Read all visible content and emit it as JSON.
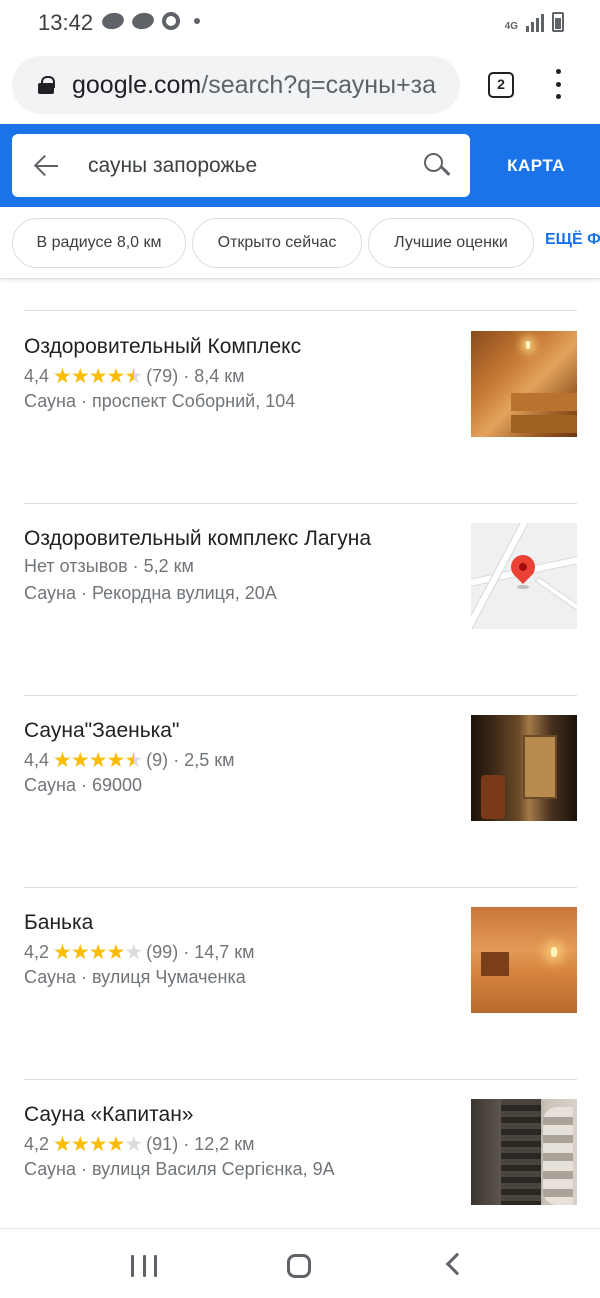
{
  "status_bar": {
    "time": "13:42",
    "network": "4G"
  },
  "browser": {
    "url_host": "google.com",
    "url_path": "/search?q=сауны+за",
    "tab_count": "2"
  },
  "search": {
    "query": "сауны запорожье",
    "map_button": "КАРТА"
  },
  "chips": [
    {
      "label": "В радиусе 8,0 км"
    },
    {
      "label": "Открыто сейчас"
    },
    {
      "label": "Лучшие оценки"
    }
  ],
  "chips_more": "ЕЩЁ Ф",
  "results": [
    {
      "title": "Оздоровительный Комплекс",
      "rating": "4,4",
      "stars": 4.5,
      "reviews": "(79)",
      "distance": "· 8,4 км",
      "address": "Сауна · проспект Соборний, 104",
      "thumb": "sauna-wood-photo"
    },
    {
      "title": "Оздоровительный комплекс Лагуна",
      "no_reviews": "Нет отзывов · 5,2 км",
      "address": "Сауна · Рекордна вулиця, 20А",
      "thumb": "map-pin-thumbnail"
    },
    {
      "title": "Сауна\"Заенька\"",
      "rating": "4,4",
      "stars": 4.5,
      "reviews": "(9)",
      "distance": "· 2,5 км",
      "address": "Сауна · 69000",
      "thumb": "sauna-dark-photo"
    },
    {
      "title": "Банька",
      "rating": "4,2",
      "stars": 4,
      "reviews": "(99)",
      "distance": "· 14,7 км",
      "address": "Сауна · вулиця Чумаченка",
      "thumb": "sauna-orange-photo"
    },
    {
      "title": "Сауна «Капитан»",
      "rating": "4,2",
      "stars": 4,
      "reviews": "(91)",
      "distance": "· 12,2 км",
      "address": "Сауна · вулиця Василя Сергієнка, 9А",
      "thumb": "sauna-stone-photo"
    }
  ],
  "nav": {
    "recents_icon": "recents-icon",
    "home_icon": "home-icon",
    "back_icon": "back-icon"
  },
  "colors": {
    "accent": "#1a73e8",
    "star": "#fbbc04",
    "pin": "#ea4335"
  }
}
